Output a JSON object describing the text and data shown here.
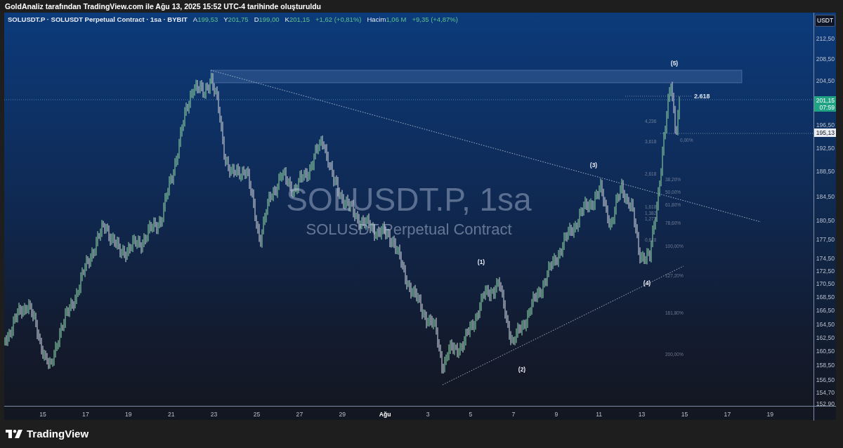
{
  "header": {
    "text": "GoldAnaliz tarafından TradingView.com ile Ağu 13, 2025 15:52 UTC-4 tarihinde oluşturuldu"
  },
  "legend": {
    "symbol": "SOLUSDT.P · SOLUSDT Perpetual Contract · 1sa · BYBIT",
    "ohlc": [
      {
        "label": "A",
        "value": "199,53"
      },
      {
        "label": "Y",
        "value": "201,75"
      },
      {
        "label": "D",
        "value": "199,00"
      },
      {
        "label": "K",
        "value": "201,15"
      }
    ],
    "change": "+1,62 (+0,81%)",
    "volume_label": "Hacim",
    "volume": "1,06 M",
    "volume_change": "+9,35 (+4,87%)"
  },
  "symbol_overlay": {
    "title": "SOLUSDT.P, 1sa",
    "description": "SOLUSDT Perpetual Contract"
  },
  "annotations": {
    "waves": [
      "(5)",
      "(3)",
      "(1)",
      "(4)",
      "(2)"
    ],
    "extension_label": "2.618",
    "fib_ratios": [
      "4,236",
      "3,618",
      "2,618",
      "1,618",
      "1,382",
      "1,272",
      "0,618"
    ],
    "fib_levels": [
      "0,00%",
      "38,20%",
      "50,00%",
      "61,80%",
      "78,60%",
      "100,00%",
      "127,20%",
      "161,80%",
      "200,00%"
    ]
  },
  "price_axis": {
    "currency": "USDT",
    "labels": [
      "212,50",
      "208,50",
      "204,50",
      "196,50",
      "192,50",
      "188,50",
      "184,50",
      "180,50",
      "177,50",
      "174,50",
      "172,50",
      "170,50",
      "168,50",
      "166,50",
      "164,50",
      "162,50",
      "160,50",
      "158,50",
      "156,50",
      "154,70",
      "152,90"
    ],
    "last_price": "201,15",
    "countdown": "07:59",
    "marked_price": "195,13"
  },
  "time_axis": {
    "labels": [
      {
        "text": "15",
        "emphasized": false
      },
      {
        "text": "17",
        "emphasized": false
      },
      {
        "text": "19",
        "emphasized": false
      },
      {
        "text": "21",
        "emphasized": false
      },
      {
        "text": "23",
        "emphasized": false
      },
      {
        "text": "25",
        "emphasized": false
      },
      {
        "text": "27",
        "emphasized": false
      },
      {
        "text": "29",
        "emphasized": false
      },
      {
        "text": "Ağu",
        "emphasized": true
      },
      {
        "text": "3",
        "emphasized": false
      },
      {
        "text": "5",
        "emphasized": false
      },
      {
        "text": "7",
        "emphasized": false
      },
      {
        "text": "9",
        "emphasized": false
      },
      {
        "text": "11",
        "emphasized": false
      },
      {
        "text": "13",
        "emphasized": false
      },
      {
        "text": "15",
        "emphasized": false
      },
      {
        "text": "17",
        "emphasized": false
      },
      {
        "text": "19",
        "emphasized": false
      }
    ]
  },
  "brand": "TradingView"
}
